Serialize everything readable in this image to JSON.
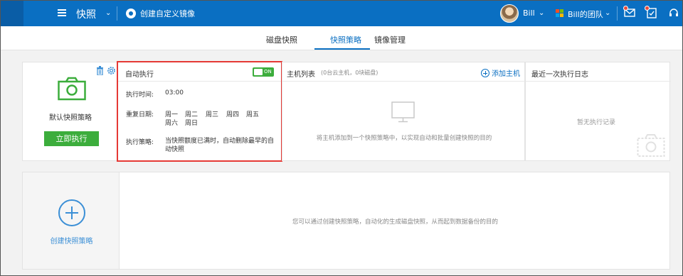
{
  "header": {
    "app_title": "快照",
    "create_mirror_label": "创建自定义镜像",
    "user_name": "Bill",
    "team_name": "Bill的团队",
    "brand_color": "#0a6fc2",
    "icons": [
      "menu-icon",
      "chevron-down-icon",
      "disc-icon",
      "avatar",
      "team-logo-icon",
      "mail-icon",
      "clipboard-check-icon",
      "headset-icon"
    ]
  },
  "tabs": [
    {
      "label": "磁盘快照",
      "active": false
    },
    {
      "label": "快照策略",
      "active": true
    },
    {
      "label": "镜像管理",
      "active": false
    }
  ],
  "policy": {
    "name": "默认快照策略",
    "run_button": "立即执行",
    "auto_exec": {
      "title": "自动执行",
      "toggle_label": "ON",
      "enabled": true,
      "time_label": "执行时间:",
      "time_value": "03:00",
      "repeat_label": "重复日期:",
      "days": [
        "周一",
        "周二",
        "周三",
        "周四",
        "周五",
        "周六",
        "周日"
      ],
      "strategy_label": "执行策略:",
      "strategy_value": "当快照额度已满时，自动删除最早的自动快照"
    },
    "hosts": {
      "title": "主机列表",
      "subtitle": "(0台云主机，0块磁盘)",
      "add_label": "添加主机",
      "empty_text": "将主机添加到一个快照策略中，以实现自动和批量创建快照的目的"
    },
    "log": {
      "title": "最近一次执行日志",
      "empty_text": "暂无执行记录"
    }
  },
  "create": {
    "label": "创建快照策略",
    "description": "您可以通过创建快照策略，自动化的生成磁盘快照，从而起到数据备份的目的"
  }
}
